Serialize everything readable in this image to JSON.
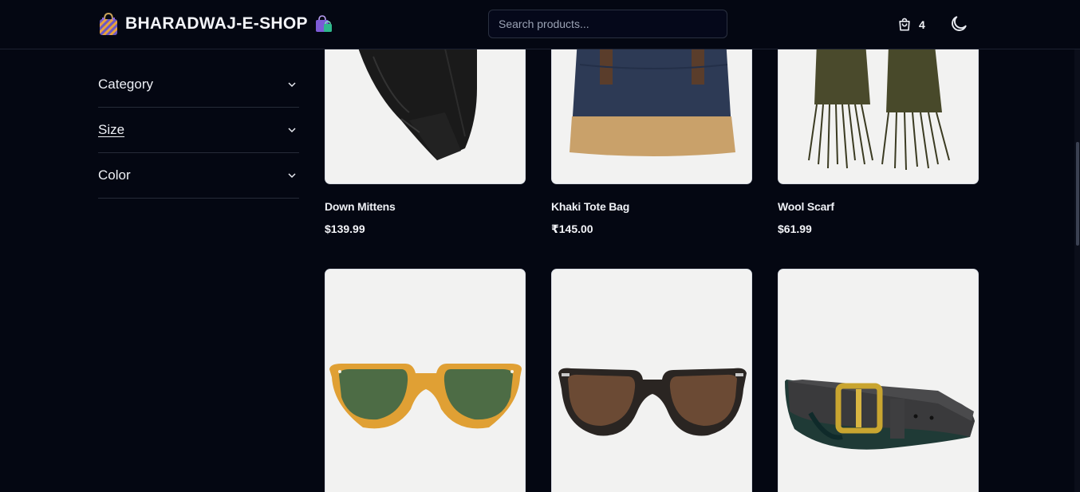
{
  "header": {
    "logo_text": "BHARADWAJ-E-SHOP",
    "search_placeholder": "Search products...",
    "cart_count": "4"
  },
  "sidebar": {
    "filters": [
      {
        "label": "Category"
      },
      {
        "label": "Size"
      },
      {
        "label": "Color"
      }
    ]
  },
  "products": [
    {
      "name": "Down Mittens",
      "price": "$139.99",
      "image": "mittens-image"
    },
    {
      "name": "Khaki Tote Bag",
      "price": "₹145.00",
      "image": "tote-bag-image"
    },
    {
      "name": "Wool Scarf",
      "price": "$61.99",
      "image": "scarf-image"
    },
    {
      "name": "",
      "price": "",
      "image": "amber-sunglasses-image"
    },
    {
      "name": "",
      "price": "",
      "image": "dark-sunglasses-image"
    },
    {
      "name": "",
      "price": "",
      "image": "leather-belt-image"
    }
  ],
  "colors": {
    "background": "#040712",
    "card_background": "#f2f2f1",
    "border": "#262b38"
  }
}
